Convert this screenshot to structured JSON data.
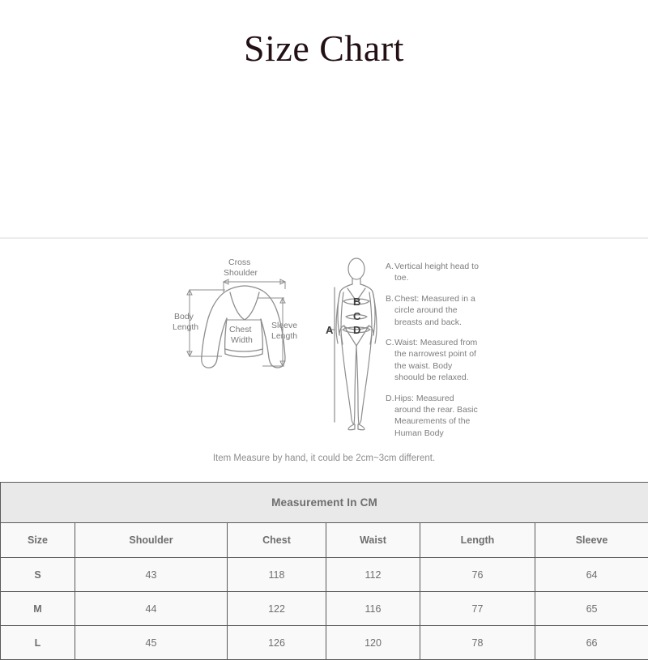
{
  "page": {
    "title": "Size Chart"
  },
  "diagram": {
    "garment": {
      "labels": {
        "cross_shoulder_line1": "Cross",
        "cross_shoulder_line2": "Shoulder",
        "body_length_line1": "Body",
        "body_length_line2": "Length",
        "chest_width_line1": "Chest",
        "chest_width_line2": "Width",
        "sleeve_length_line1": "Sleeve",
        "sleeve_length_line2": "Length"
      }
    },
    "body": {
      "markers": {
        "a": "A",
        "b": "B",
        "c": "C",
        "d": "D"
      }
    },
    "legend": [
      {
        "key": "A.",
        "text": "Vertical height head to toe."
      },
      {
        "key": "B.",
        "text": "Chest: Measured in a circle around the breasts and back."
      },
      {
        "key": "C.",
        "text": "Waist: Measured from the narrowest point of the waist. Body shoould be relaxed."
      },
      {
        "key": "D.",
        "text": "Hips: Measured around the rear. Basic Meaurements of the Human Body"
      }
    ],
    "note": "Item Measure by hand, it could be 2cm~3cm different."
  },
  "table": {
    "caption": "Measurement In CM",
    "columns": [
      "Size",
      "Shoulder",
      "Chest",
      "Waist",
      "Length",
      "Sleeve"
    ],
    "rows": [
      {
        "size": "S",
        "shoulder": "43",
        "chest": "118",
        "waist": "112",
        "length": "76",
        "sleeve": "64"
      },
      {
        "size": "M",
        "shoulder": "44",
        "chest": "122",
        "waist": "116",
        "length": "77",
        "sleeve": "65"
      },
      {
        "size": "L",
        "shoulder": "45",
        "chest": "126",
        "waist": "120",
        "length": "78",
        "sleeve": "66"
      }
    ]
  },
  "colors": {
    "title": "#231014",
    "text": "#7d7d7d",
    "table_header_bg": "#e9e9e9",
    "table_cell_bg": "#f9f9f9",
    "table_border": "#5a5a5a",
    "line": "#8d8d8d"
  }
}
